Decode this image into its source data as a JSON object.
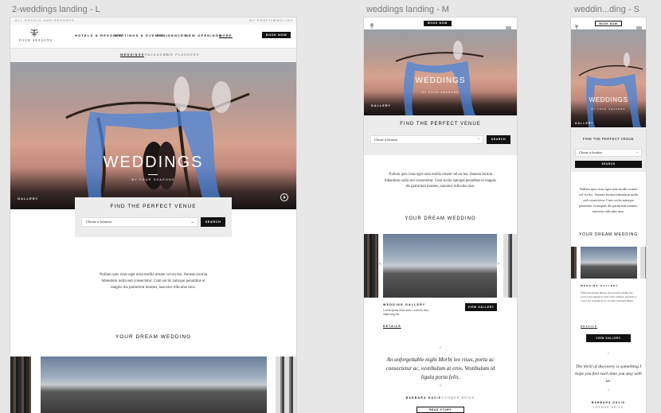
{
  "labels": {
    "large": "2-weddings landing - L",
    "medium": "weddings landing - M",
    "small": "weddin...ding - S"
  },
  "large": {
    "util_left": "ALL HOTELS AND RESORTS",
    "util_right": [
      "MY PROFILE",
      "ENGLISH"
    ],
    "logo": "FOUR SEASONS",
    "nav": [
      "HOTELS & RESORTS",
      "MEETINGS & EVENTS",
      "RESIDENCES",
      "NEW OPENINGS",
      "MORE"
    ],
    "book": "BOOK NOW",
    "subnav": [
      "WEDDINGS",
      "PACKAGES",
      "OUR PLANNERS"
    ],
    "hero_title": "WEDDINGS",
    "hero_sub": "BY FOUR SEASONS",
    "gallery": "GALLERY",
    "venue_title": "FIND THE PERFECT VENUE",
    "select_placeholder": "Choose a location",
    "search": "SEARCH",
    "intro": "Nullam quis risus eget urna mollis ornare vel eu leo. Aenean lacinia bibendum nulla sed consectetur. Cum sociis natoque penatibus et magnis dis parturient montes, nascetur ridiculus mus.",
    "dream": "YOUR DREAM WEDDING"
  },
  "medium": {
    "book": "BOOK NOW",
    "hero_title": "WEDDINGS",
    "hero_sub": "BY FOUR SEASONS",
    "gallery": "GALLERY",
    "venue_title": "FIND THE PERFECT VENUE",
    "select_placeholder": "Choose a location",
    "search": "SEARCH",
    "intro": "Nullam quis risus eget urna mollis ornare vel eu leo. Aenean lacinia bibendum nulla sed consectetur. Cum sociis natoque penatibus et magnis dis parturient montes, nascetur ridiculus mus.",
    "dream": "YOUR DREAM WEDDING",
    "card_title": "WEDDING GALLERY",
    "card_text": "Lorem ipsum dolor amet, consecte tetur adipiscing elit.",
    "card_btn": "VIEW GALLERY",
    "details": "DETAILS",
    "quote": "An unforgettable night Morbi leo risus, porta ac consectetur ac, vestibulum at eros. Vestibulum id ligula porta felis.",
    "quote_author": "BARBARA DAVIS",
    "quote_role": "FORMER BRIDE",
    "read_story": "READ STORY"
  },
  "small": {
    "book": "BOOK NOW",
    "hero_title": "WEDDINGS",
    "hero_sub": "BY FOUR SEASONS",
    "gallery": "GALLERY",
    "venue_title": "FIND THE PERFECT VENUE",
    "select_placeholder": "Choose a location",
    "search": "SEARCH",
    "intro": "Nullam quis risus eget urna mollis ornare vel eu leo. Aenean lacinia bibendum nulla sed consectetur. Cum sociis natoque penatibus et magnis dis parturient montes, nascetur ridiculus mus.",
    "dream": "YOUR DREAM WEDDING",
    "card_title": "WEDDING GALLERY",
    "card_text": "With Oris Indian dining and poolside drinks, the soul of the legendary Surf Club remains, elevated to a new era of glamour by architect Richard Meier.",
    "details": "DETAILS",
    "card_btn": "VIEW GALLERY",
    "quote": "The thrill of discovery is something I hope you feel each time you stay with us.",
    "quote_author": "BARBARA DAVIS",
    "quote_role": "FORMER BRIDE"
  }
}
